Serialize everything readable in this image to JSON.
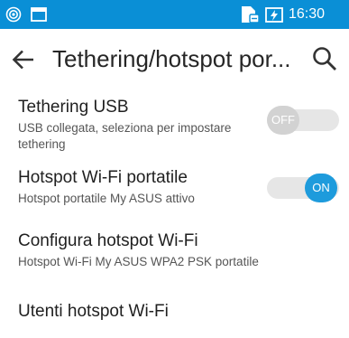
{
  "status_bar": {
    "time": "16:30",
    "icons": [
      "hotspot-icon",
      "message-icon",
      "sim-icon",
      "battery-charging-icon"
    ],
    "background": "#0a8fd6"
  },
  "app_bar": {
    "title": "Tethering/hotspot por...",
    "back_icon": "back-arrow-icon",
    "search_icon": "search-icon"
  },
  "settings": [
    {
      "title": "Tethering USB",
      "subtitle_line1": "USB collegata, seleziona per impostare",
      "subtitle_line2": "tethering",
      "toggle": {
        "state": "off",
        "label": "OFF"
      }
    },
    {
      "title": "Hotspot Wi-Fi portatile",
      "subtitle": "Hotspot portatile My ASUS attivo",
      "toggle": {
        "state": "on",
        "label": "ON"
      }
    },
    {
      "title": "Configura hotspot Wi-Fi",
      "subtitle": "Hotspot Wi-Fi My ASUS WPA2 PSK portatile"
    },
    {
      "title": "Utenti hotspot Wi-Fi"
    }
  ],
  "colors": {
    "accent": "#1e9bdc",
    "toggle_off": "#d2d2d2",
    "track": "#e6e6e6"
  }
}
